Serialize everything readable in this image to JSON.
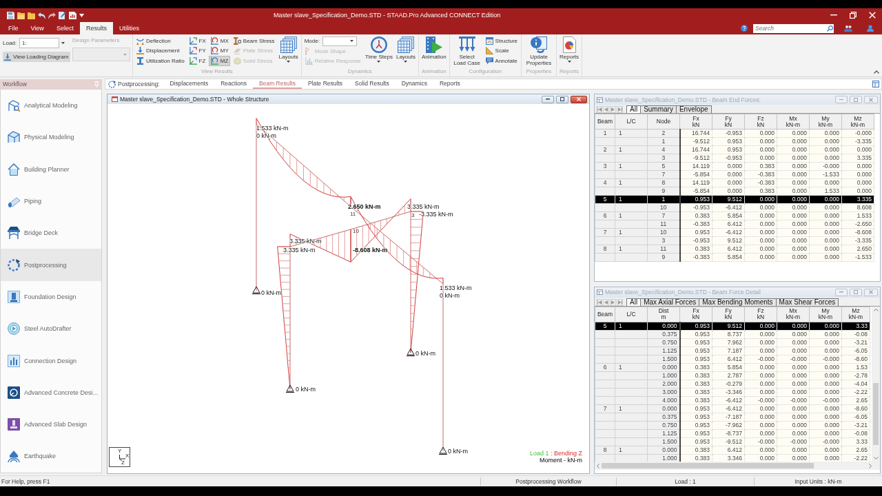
{
  "title_bar": {
    "title": "Master slave_Specification_Demo.STD - STAAD.Pro Advanced CONNECT Edition"
  },
  "menu_tabs": [
    {
      "label": "File",
      "selected": false
    },
    {
      "label": "View",
      "selected": false
    },
    {
      "label": "Select",
      "selected": false
    },
    {
      "label": "Results",
      "selected": true
    },
    {
      "label": "Utilities",
      "selected": false
    }
  ],
  "search": {
    "placeholder": "Search"
  },
  "ribbon": {
    "load": {
      "label": "Load:",
      "value": "1:"
    },
    "view_loading_diagram": {
      "label": "View Loading Diagram",
      "hovered": true
    },
    "design_parameters": {
      "label": "Design Parameters",
      "disabled": true
    },
    "groups": [
      {
        "title": "View Results",
        "columns": [
          {
            "kind": "stack",
            "items": [
              {
                "kind": "button",
                "label": "Deflection",
                "selected": false,
                "disabled": false
              },
              {
                "kind": "button",
                "label": "Displacement",
                "selected": false,
                "disabled": false
              },
              {
                "kind": "button",
                "label": "Utilization Ratio",
                "selected": false,
                "disabled": false
              }
            ]
          },
          {
            "kind": "stack",
            "items": [
              {
                "kind": "button",
                "label": "FX",
                "selected": false,
                "disabled": false
              },
              {
                "kind": "button",
                "label": "FY",
                "selected": false,
                "disabled": false
              },
              {
                "kind": "button",
                "label": "FZ",
                "selected": false,
                "disabled": false
              }
            ]
          },
          {
            "kind": "stack",
            "items": [
              {
                "kind": "button",
                "label": "MX",
                "selected": false,
                "disabled": false
              },
              {
                "kind": "button",
                "label": "MY",
                "selected": false,
                "disabled": false
              },
              {
                "kind": "button",
                "label": "MZ",
                "selected": true,
                "disabled": false
              }
            ]
          },
          {
            "kind": "stack",
            "items": [
              {
                "kind": "button",
                "label": "Beam Stress",
                "selected": false,
                "disabled": false
              },
              {
                "kind": "button",
                "label": "Plate Stress",
                "selected": false,
                "disabled": true
              },
              {
                "kind": "button",
                "label": "Solid Stress",
                "selected": false,
                "disabled": true
              }
            ]
          },
          {
            "kind": "large",
            "label": "Layouts",
            "dropdown": true
          }
        ]
      },
      {
        "title": "Dynamics",
        "columns": [
          {
            "kind": "stack",
            "items": [
              {
                "kind": "combo",
                "label": "Mode:"
              },
              {
                "kind": "button",
                "label": "Mode Shape",
                "selected": false,
                "disabled": true
              },
              {
                "kind": "button",
                "label": "Relative Response",
                "selected": false,
                "disabled": true
              }
            ]
          },
          {
            "kind": "large",
            "label": "Time Steps",
            "dropdown": true
          },
          {
            "kind": "large",
            "label": "Layouts",
            "dropdown": true
          }
        ]
      },
      {
        "title": "Animation",
        "columns": [
          {
            "kind": "large",
            "label": "Animation",
            "dropdown": false
          }
        ]
      },
      {
        "title": "Configuration",
        "columns": [
          {
            "kind": "large",
            "label": "Select Load Case",
            "dropdown": false
          },
          {
            "kind": "stack",
            "items": [
              {
                "kind": "button",
                "label": "Structure",
                "selected": false,
                "disabled": false
              },
              {
                "kind": "button",
                "label": "Scale",
                "selected": false,
                "disabled": false
              },
              {
                "kind": "button",
                "label": "Annotate",
                "selected": false,
                "disabled": false
              }
            ]
          }
        ]
      },
      {
        "title": "Properties",
        "columns": [
          {
            "kind": "large",
            "label": "Update Properties",
            "dropdown": false
          }
        ]
      },
      {
        "title": "Reports",
        "columns": [
          {
            "kind": "large",
            "label": "Reports",
            "dropdown": true
          }
        ]
      }
    ]
  },
  "workflow": {
    "title": "Workflow",
    "items": [
      {
        "label": "Analytical Modeling",
        "selected": false
      },
      {
        "label": "Physical Modeling",
        "selected": false
      },
      {
        "label": "Building Planner",
        "selected": false
      },
      {
        "label": "Piping",
        "selected": false
      },
      {
        "label": "Bridge Deck",
        "selected": false
      },
      {
        "label": "Postprocessing",
        "selected": true
      },
      {
        "label": "Foundation Design",
        "selected": false
      },
      {
        "label": "Steel AutoDrafter",
        "selected": false
      },
      {
        "label": "Connection Design",
        "selected": false
      },
      {
        "label": "Advanced Concrete Desi...",
        "selected": false
      },
      {
        "label": "Advanced Slab Design",
        "selected": false
      },
      {
        "label": "Earthquake",
        "selected": false
      }
    ]
  },
  "page_tabs": {
    "section": "Postprocessing:",
    "tabs": [
      {
        "label": "Displacements",
        "selected": false
      },
      {
        "label": "Reactions",
        "selected": false
      },
      {
        "label": "Beam Results",
        "selected": true
      },
      {
        "label": "Plate Results",
        "selected": false
      },
      {
        "label": "Solid Results",
        "selected": false
      },
      {
        "label": "Dynamics",
        "selected": false
      },
      {
        "label": "Reports",
        "selected": false
      }
    ]
  },
  "viewport": {
    "title": "Master slave_Specification_Demo.STD - Whole Structure",
    "moment_labels": [
      "1.533 kN-m",
      "0 kN-m",
      "2.650 kN-m",
      "3.335 kN-m",
      "-3.335 kN-m",
      "3.335 kN-m",
      "3.335 kN-m",
      "-8.608 kN-m",
      "1.533 kN-m",
      "0 kN-m",
      "0 kN-m",
      "0 kN-m",
      "0 kN-m",
      "0 kN-m"
    ],
    "node_labels": [
      "11",
      "3",
      "10"
    ],
    "axis_labels": [
      "Y",
      "X",
      "Z"
    ],
    "legend": {
      "load": "Load 1",
      "result": ": Bending Z",
      "units": "Moment - kN-m"
    }
  },
  "tables": [
    {
      "title": "Master slave_Specification_Demo.STD - Beam End Forces:",
      "tabs": [
        {
          "label": "All",
          "selected": true
        },
        {
          "label": "Summary",
          "selected": false
        },
        {
          "label": "Envelope",
          "selected": false
        }
      ],
      "columns": [
        {
          "label": "Beam"
        },
        {
          "label": "L/C"
        },
        {
          "label": "Node"
        },
        {
          "label": "Fx",
          "unit": "kN"
        },
        {
          "label": "Fy",
          "unit": "kN"
        },
        {
          "label": "Fz",
          "unit": "kN"
        },
        {
          "label": "Mx",
          "unit": "kN-m"
        },
        {
          "label": "My",
          "unit": "kN-m"
        },
        {
          "label": "Mz",
          "unit": "kN-m"
        }
      ],
      "rows": [
        {
          "cells": [
            "1",
            "1",
            "2",
            "16.744",
            "-0.953",
            "0.000",
            "0.000",
            "0.000",
            "-0.000"
          ],
          "selected": false
        },
        {
          "cells": [
            "",
            "",
            "1",
            "-9.512",
            "0.953",
            "0.000",
            "0.000",
            "0.000",
            "-3.335"
          ],
          "selected": false
        },
        {
          "cells": [
            "2",
            "1",
            "4",
            "16.744",
            "0.953",
            "0.000",
            "0.000",
            "0.000",
            "0.000"
          ],
          "selected": false
        },
        {
          "cells": [
            "",
            "",
            "3",
            "-9.512",
            "-0.953",
            "0.000",
            "0.000",
            "0.000",
            "3.335"
          ],
          "selected": false
        },
        {
          "cells": [
            "3",
            "1",
            "5",
            "14.119",
            "0.000",
            "0.383",
            "0.000",
            "-0.000",
            "0.000"
          ],
          "selected": false
        },
        {
          "cells": [
            "",
            "",
            "7",
            "-5.854",
            "0.000",
            "-0.383",
            "0.000",
            "-1.533",
            "0.000"
          ],
          "selected": false
        },
        {
          "cells": [
            "4",
            "1",
            "8",
            "14.119",
            "0.000",
            "-0.383",
            "0.000",
            "0.000",
            "0.000"
          ],
          "selected": false
        },
        {
          "cells": [
            "",
            "",
            "9",
            "-5.854",
            "0.000",
            "0.383",
            "0.000",
            "1.533",
            "0.000"
          ],
          "selected": false
        },
        {
          "cells": [
            "5",
            "1",
            "1",
            "0.953",
            "9.512",
            "0.000",
            "0.000",
            "0.000",
            "3.335"
          ],
          "selected": true
        },
        {
          "cells": [
            "",
            "",
            "10",
            "-0.953",
            "-6.412",
            "0.000",
            "0.000",
            "0.000",
            "8.608"
          ],
          "selected": false
        },
        {
          "cells": [
            "6",
            "1",
            "7",
            "0.383",
            "5.854",
            "0.000",
            "0.000",
            "0.000",
            "1.533"
          ],
          "selected": false
        },
        {
          "cells": [
            "",
            "",
            "11",
            "-0.383",
            "6.412",
            "0.000",
            "0.000",
            "0.000",
            "-2.650"
          ],
          "selected": false
        },
        {
          "cells": [
            "7",
            "1",
            "10",
            "0.953",
            "-6.412",
            "0.000",
            "0.000",
            "0.000",
            "-8.608"
          ],
          "selected": false
        },
        {
          "cells": [
            "",
            "",
            "3",
            "-0.953",
            "9.512",
            "0.000",
            "0.000",
            "0.000",
            "-3.335"
          ],
          "selected": false
        },
        {
          "cells": [
            "8",
            "1",
            "11",
            "0.383",
            "6.412",
            "0.000",
            "0.000",
            "0.000",
            "2.650"
          ],
          "selected": false
        },
        {
          "cells": [
            "",
            "",
            "9",
            "-0.383",
            "5.854",
            "0.000",
            "0.000",
            "0.000",
            "-1.533"
          ],
          "selected": false
        }
      ]
    },
    {
      "title": "Master slave_Specification_Demo.STD - Beam Force Detail",
      "tabs": [
        {
          "label": "All",
          "selected": true
        },
        {
          "label": "Max Axial Forces",
          "selected": false
        },
        {
          "label": "Max Bending Moments",
          "selected": false
        },
        {
          "label": "Max Shear Forces",
          "selected": false
        }
      ],
      "columns": [
        {
          "label": "Beam"
        },
        {
          "label": "L/C"
        },
        {
          "label": "Dist",
          "unit": "m"
        },
        {
          "label": "Fx",
          "unit": "kN"
        },
        {
          "label": "Fy",
          "unit": "kN"
        },
        {
          "label": "Fz",
          "unit": "kN"
        },
        {
          "label": "Mx",
          "unit": "kN-m"
        },
        {
          "label": "My",
          "unit": "kN-m"
        },
        {
          "label": "Mz",
          "unit": "kN-m"
        }
      ],
      "rows": [
        {
          "cells": [
            "5",
            "1",
            "0.000",
            "0.953",
            "9.512",
            "0.000",
            "0.000",
            "0.000",
            "3.33"
          ],
          "selected": true
        },
        {
          "cells": [
            "",
            "",
            "0.375",
            "0.953",
            "8.737",
            "0.000",
            "0.000",
            "0.000",
            "-0.08"
          ],
          "selected": false
        },
        {
          "cells": [
            "",
            "",
            "0.750",
            "0.953",
            "7.962",
            "0.000",
            "0.000",
            "0.000",
            "-3.21"
          ],
          "selected": false
        },
        {
          "cells": [
            "",
            "",
            "1.125",
            "0.953",
            "7.187",
            "0.000",
            "0.000",
            "0.000",
            "-6.05"
          ],
          "selected": false
        },
        {
          "cells": [
            "",
            "",
            "1.500",
            "0.953",
            "6.412",
            "-0.000",
            "-0.000",
            "-0.000",
            "-8.60"
          ],
          "selected": false
        },
        {
          "cells": [
            "6",
            "1",
            "0.000",
            "0.383",
            "5.854",
            "0.000",
            "0.000",
            "0.000",
            "1.53"
          ],
          "selected": false
        },
        {
          "cells": [
            "",
            "",
            "1.000",
            "0.383",
            "2.787",
            "0.000",
            "0.000",
            "0.000",
            "-2.78"
          ],
          "selected": false
        },
        {
          "cells": [
            "",
            "",
            "2.000",
            "0.383",
            "-0.279",
            "0.000",
            "0.000",
            "0.000",
            "-4.04"
          ],
          "selected": false
        },
        {
          "cells": [
            "",
            "",
            "3.000",
            "0.383",
            "-3.346",
            "0.000",
            "0.000",
            "0.000",
            "-2.22"
          ],
          "selected": false
        },
        {
          "cells": [
            "",
            "",
            "4.000",
            "0.383",
            "-6.412",
            "-0.000",
            "-0.000",
            "-0.000",
            "2.65"
          ],
          "selected": false
        },
        {
          "cells": [
            "7",
            "1",
            "0.000",
            "0.953",
            "-6.412",
            "0.000",
            "0.000",
            "0.000",
            "-8.60"
          ],
          "selected": false
        },
        {
          "cells": [
            "",
            "",
            "0.375",
            "0.953",
            "-7.187",
            "0.000",
            "0.000",
            "0.000",
            "-6.05"
          ],
          "selected": false
        },
        {
          "cells": [
            "",
            "",
            "0.750",
            "0.953",
            "-7.962",
            "0.000",
            "0.000",
            "0.000",
            "-3.21"
          ],
          "selected": false
        },
        {
          "cells": [
            "",
            "",
            "1.125",
            "0.953",
            "-8.737",
            "0.000",
            "0.000",
            "0.000",
            "-0.08"
          ],
          "selected": false
        },
        {
          "cells": [
            "",
            "",
            "1.500",
            "0.953",
            "-9.512",
            "-0.000",
            "-0.000",
            "-0.000",
            "3.33"
          ],
          "selected": false
        },
        {
          "cells": [
            "8",
            "1",
            "0.000",
            "0.383",
            "6.412",
            "0.000",
            "0.000",
            "0.000",
            "2.65"
          ],
          "selected": false
        },
        {
          "cells": [
            "",
            "",
            "1.000",
            "0.383",
            "3.346",
            "0.000",
            "0.000",
            "0.000",
            "-2.22"
          ],
          "selected": false
        }
      ]
    }
  ],
  "status_bar": {
    "help": "For Help, press F1",
    "workflow": "Postprocessing Workflow",
    "load": "Load : 1",
    "units": "Input Units : kN-m"
  }
}
